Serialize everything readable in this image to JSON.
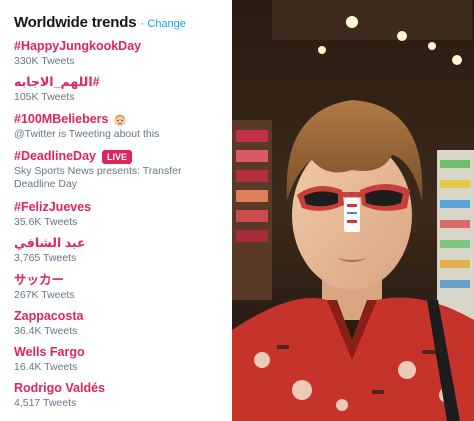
{
  "header": {
    "title": "Worldwide trends",
    "separator": "·",
    "change_label": "Change"
  },
  "trends": [
    {
      "name": "#HappyJungkookDay",
      "meta": "330K Tweets"
    },
    {
      "name": "#اللهم_الاجابه",
      "meta": "105K Tweets"
    },
    {
      "name": "#100MBeliebers",
      "meta": "@Twitter is Tweeting about this"
    },
    {
      "name": "#DeadlineDay",
      "badge": "LIVE",
      "meta": "Sky Sports News presents: Transfer Deadline Day"
    },
    {
      "name": "#FelizJueves",
      "meta": "35.6K Tweets"
    },
    {
      "name": "عبد الشافي",
      "meta": "3,765 Tweets"
    },
    {
      "name": "サッカー",
      "meta": "267K Tweets"
    },
    {
      "name": "Zappacosta",
      "meta": "36.4K Tweets"
    },
    {
      "name": "Wells Fargo",
      "meta": "16.4K Tweets"
    },
    {
      "name": "Rodrigo Valdés",
      "meta": "4,517 Tweets"
    }
  ],
  "photo": {
    "accent": "#e0245e",
    "link": "#1da1f2",
    "icons": [
      "emoji-face-icon",
      "live-badge"
    ]
  }
}
